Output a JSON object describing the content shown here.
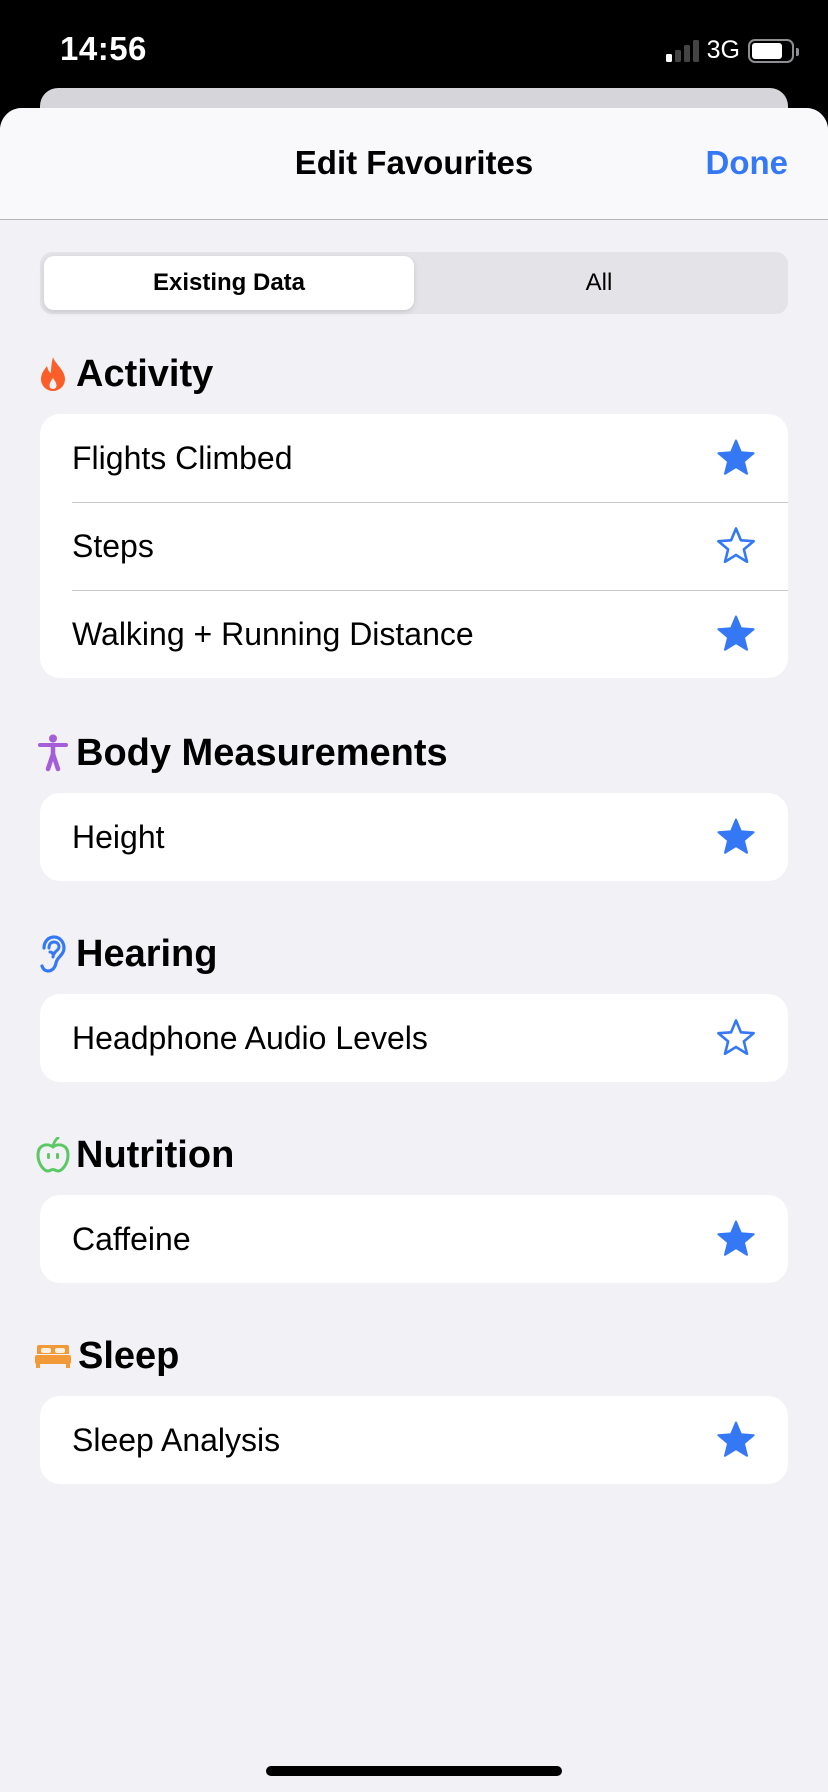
{
  "status_bar": {
    "time": "14:56",
    "network": "3G",
    "signal_bars_active": 1,
    "signal_bars_total": 4,
    "battery_level": 0.8
  },
  "nav": {
    "title": "Edit Favourites",
    "done_label": "Done"
  },
  "segmented_control": {
    "options": [
      "Existing Data",
      "All"
    ],
    "selected": "Existing Data"
  },
  "colors": {
    "accent": "#3478f6",
    "activity": "#fa5f2a",
    "body_measurements": "#a55ed8",
    "hearing": "#3478f6",
    "nutrition": "#5cc865",
    "sleep": "#f29a38"
  },
  "sections": [
    {
      "title": "Activity",
      "icon": "flame-icon",
      "items": [
        {
          "label": "Flights Climbed",
          "favourite": true
        },
        {
          "label": "Steps",
          "favourite": false
        },
        {
          "label": "Walking + Running Distance",
          "favourite": true
        }
      ]
    },
    {
      "title": "Body Measurements",
      "icon": "figure-icon",
      "items": [
        {
          "label": "Height",
          "favourite": true
        }
      ]
    },
    {
      "title": "Hearing",
      "icon": "ear-icon",
      "items": [
        {
          "label": "Headphone Audio Levels",
          "favourite": false
        }
      ]
    },
    {
      "title": "Nutrition",
      "icon": "apple-icon",
      "items": [
        {
          "label": "Caffeine",
          "favourite": true
        }
      ]
    },
    {
      "title": "Sleep",
      "icon": "bed-icon",
      "items": [
        {
          "label": "Sleep Analysis",
          "favourite": true
        }
      ]
    }
  ]
}
